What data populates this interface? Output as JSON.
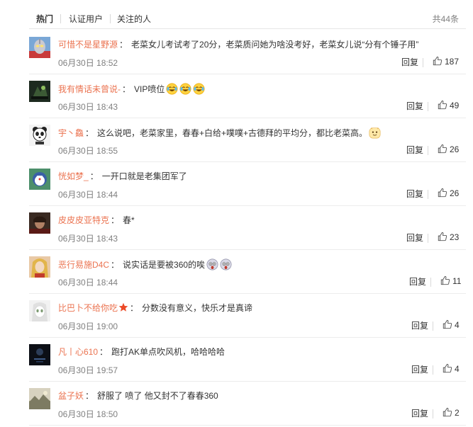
{
  "tabs": [
    {
      "label": "热门",
      "active": true
    },
    {
      "label": "认证用户",
      "active": false
    },
    {
      "label": "关注的人",
      "active": false
    }
  ],
  "total_label": "共44条",
  "reply_label": "回复",
  "colors": {
    "username": "#eb7350",
    "meta": "#808080",
    "text": "#333333"
  },
  "comments": [
    {
      "user": "可惜不是星野源",
      "text": "老菜女儿考试考了20分，老菜质问她为啥没考好，老菜女儿说“分有个锤子用”",
      "emojis": [],
      "time": "06月30日 18:52",
      "likes": "187",
      "avatar": "ultraman-avatar"
    },
    {
      "user": "我有情话未曾说-",
      "text": "VIP喷位",
      "emojis": [
        "laugh-cry-emoji",
        "laugh-cry-emoji",
        "laugh-cry-emoji"
      ],
      "time": "06月30日 18:43",
      "likes": "49",
      "avatar": "dark-game-avatar"
    },
    {
      "user": "宇丶鱻",
      "text": "这么说吧，老菜家里，春春+白给+噗噗+古德拜的平均分，都比老菜高。",
      "emojis": [
        "smirk-emoji"
      ],
      "time": "06月30日 18:55",
      "likes": "26",
      "avatar": "panda-avatar"
    },
    {
      "user": "恍如梦_",
      "text": "一开口就是老集团军了",
      "emojis": [],
      "time": "06月30日 18:44",
      "likes": "26",
      "avatar": "cartoon-avatar"
    },
    {
      "user": "皮皮皮亚特克",
      "text": "春*",
      "emojis": [],
      "time": "06月30日 18:43",
      "likes": "23",
      "avatar": "warrior-avatar"
    },
    {
      "user": "恶行易施D4C",
      "text": "说实话是要被360的唉",
      "emojis": [
        "fear-emoji",
        "fear-emoji"
      ],
      "time": "06月30日 18:44",
      "likes": "11",
      "avatar": "blonde-avatar"
    },
    {
      "user": "比巴卜不给你吃",
      "text": "分数没有意义，快乐才是真谛",
      "emojis": [],
      "time": "06月30日 19:00",
      "likes": "4",
      "avatar": "anime-avatar",
      "badge": "vip-star-icon"
    },
    {
      "user": "凡丨心610",
      "text": "跑打AK单点吹风机，哈哈哈哈",
      "emojis": [],
      "time": "06月30日 19:57",
      "likes": "4",
      "avatar": "night-avatar"
    },
    {
      "user": "盆子妖",
      "text": "舒服了 喷了 他又封不了春春360",
      "emojis": [],
      "time": "06月30日 18:50",
      "likes": "2",
      "avatar": "landscape-avatar"
    }
  ]
}
